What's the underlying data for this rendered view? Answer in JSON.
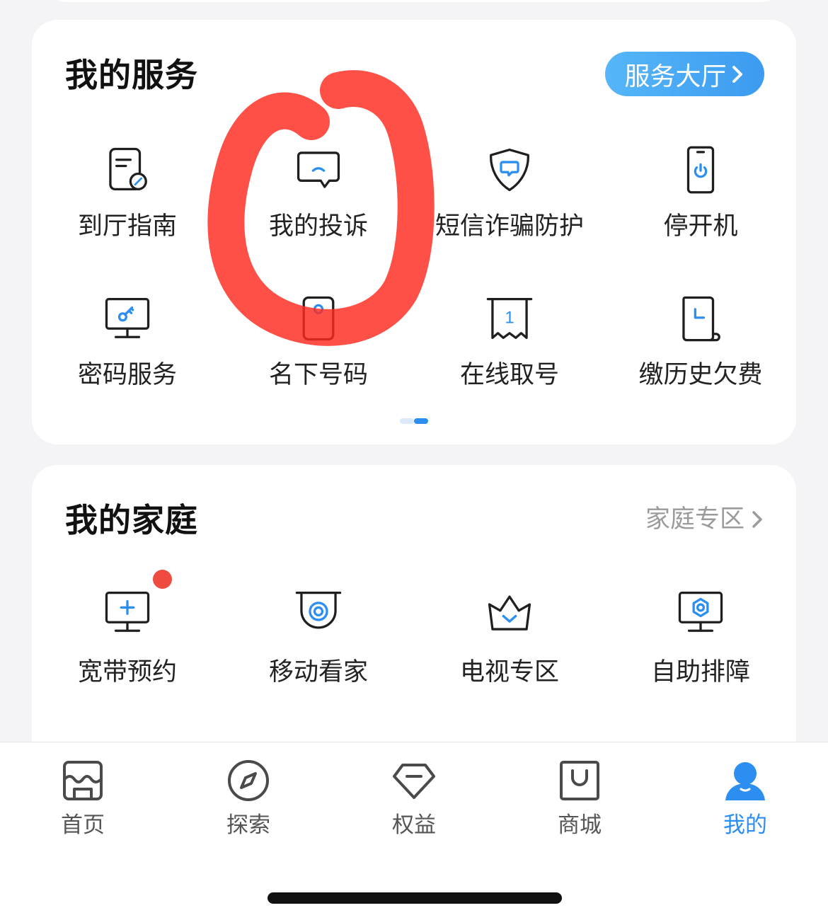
{
  "service_card": {
    "title": "我的服务",
    "hall_button": "服务大厅",
    "items": [
      {
        "label": "到厅指南",
        "icon": "document-compass-icon"
      },
      {
        "label": "我的投诉",
        "icon": "chat-bubble-icon"
      },
      {
        "label": "短信诈骗防护",
        "icon": "shield-message-icon"
      },
      {
        "label": "停开机",
        "icon": "phone-power-icon"
      },
      {
        "label": "密码服务",
        "icon": "monitor-key-icon"
      },
      {
        "label": "名下号码",
        "icon": "phone-card-icon"
      },
      {
        "label": "在线取号",
        "icon": "ticket-icon",
        "ticket_number": "1"
      },
      {
        "label": "缴历史欠费",
        "icon": "bill-scroll-icon"
      }
    ],
    "pager": {
      "page_count": 2,
      "active_page": 2
    }
  },
  "family_card": {
    "title": "我的家庭",
    "zone_link": "家庭专区",
    "items": [
      {
        "label": "宽带预约",
        "icon": "monitor-plus-icon",
        "has_badge": true
      },
      {
        "label": "移动看家",
        "icon": "camera-icon"
      },
      {
        "label": "电视专区",
        "icon": "crown-icon"
      },
      {
        "label": "自助排障",
        "icon": "monitor-nut-icon"
      }
    ]
  },
  "tab_bar": {
    "items": [
      {
        "label": "首页",
        "icon": "storefront-icon"
      },
      {
        "label": "探索",
        "icon": "compass-icon"
      },
      {
        "label": "权益",
        "icon": "diamond-icon"
      },
      {
        "label": "商城",
        "icon": "shopping-bag-icon"
      },
      {
        "label": "我的",
        "icon": "person-icon"
      }
    ],
    "active_index": 4
  },
  "colors": {
    "accent": "#2b8ef0",
    "badge": "#ef4b3f",
    "marker": "#ff2a1f",
    "icon_stroke": "#1f1f1f",
    "tab_inactive": "#555555"
  }
}
